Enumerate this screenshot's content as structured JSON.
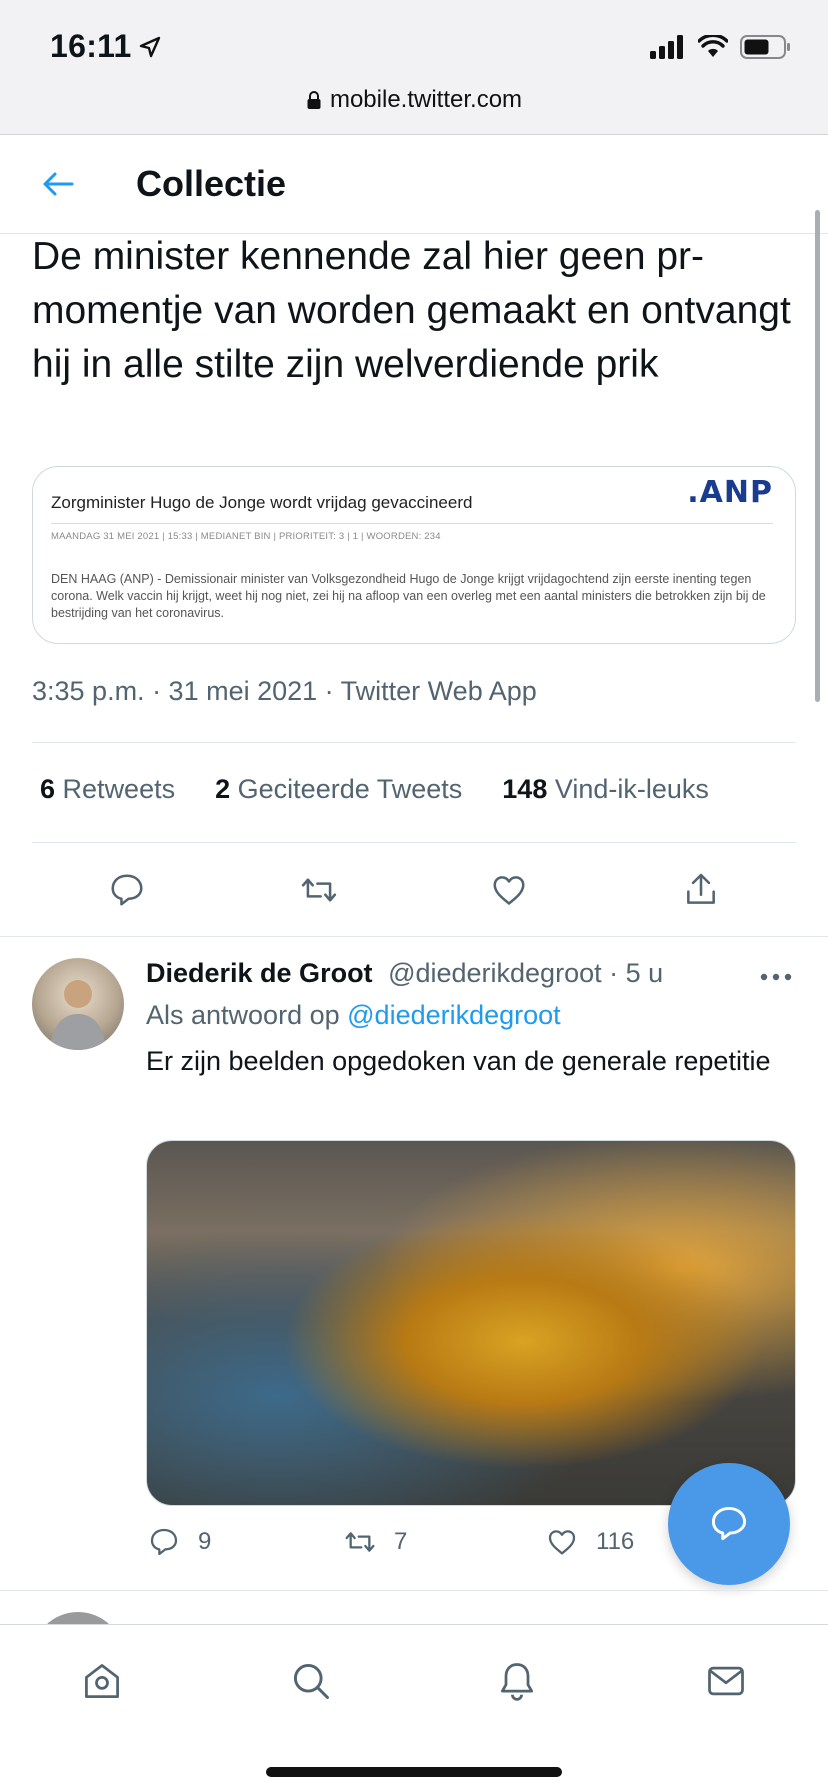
{
  "status_bar": {
    "time": "16:11"
  },
  "url_bar": {
    "url": "mobile.twitter.com"
  },
  "header": {
    "title": "Collectie"
  },
  "main_tweet": {
    "text": "De minister kennende zal hier geen pr-momentje van worden gemaakt en ontvangt hij in alle stilte zijn welverdiende prik",
    "card": {
      "headline": "Zorgminister Hugo de Jonge wordt vrijdag gevaccineerd",
      "logo": ".ANP",
      "meta": "MAANDAG 31 MEI 2021 | 15:33  | MEDIANET BIN  | PRIORITEIT: 3 | 1 | WOORDEN: 234",
      "body": "DEN HAAG (ANP) - Demissionair minister van Volksgezondheid Hugo de Jonge krijgt vrijdagochtend zijn eerste inenting tegen corona. Welk vaccin hij krijgt, weet hij nog niet, zei hij na afloop van een overleg met een aantal ministers die betrokken zijn bij de bestrijding van het coronavirus."
    },
    "timestamp": "3:35 p.m. · 31 mei 2021 · Twitter Web App",
    "stats": {
      "retweets_count": "6",
      "retweets_label": "Retweets",
      "quotes_count": "2",
      "quotes_label": "Geciteerde Tweets",
      "likes_count": "148",
      "likes_label": "Vind-ik-leuks"
    },
    "actions": [
      "reply-icon",
      "retweet-icon",
      "like-icon",
      "share-icon"
    ]
  },
  "reply_tweet": {
    "name": "Diederik de Groot",
    "handle_time": "@diederikdegroot · 5 u",
    "reply_to_prefix": "Als antwoord op",
    "reply_to_handle": "@diederikdegroot",
    "text": "Er zijn beelden opgedoken van de generale repetitie",
    "replies": "9",
    "retweets": "7",
    "likes": "116"
  },
  "colors": {
    "accent": "#1d9bf0",
    "fab": "#4a99e9",
    "text_secondary": "#536471",
    "anp_blue": "#1a3c8e"
  },
  "bottom_nav": [
    "home-icon",
    "search-icon",
    "notifications-icon",
    "messages-icon"
  ]
}
